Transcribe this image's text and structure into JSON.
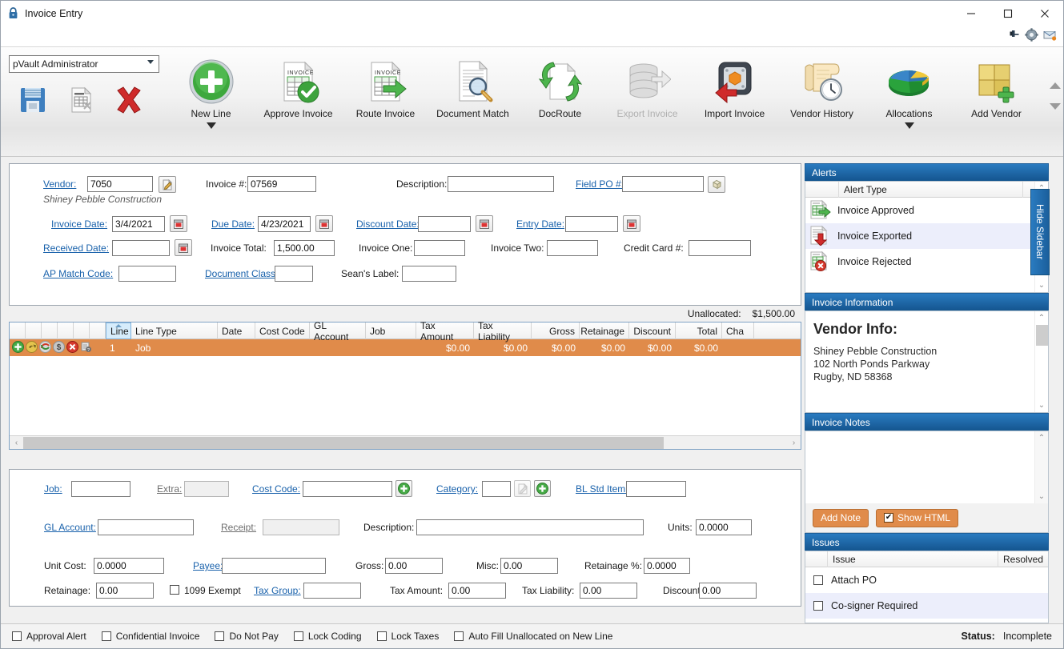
{
  "window": {
    "title": "Invoice Entry",
    "minimize": "—",
    "maximize": "▢",
    "close": "✕"
  },
  "quick_icons": [
    "pin-icon",
    "gear-icon",
    "mail-icon"
  ],
  "ribbon": {
    "user_select": {
      "value": "pVault Administrator"
    },
    "small_buttons": [
      {
        "name": "save-button",
        "icon": "floppy-disk-icon"
      },
      {
        "name": "save-invoice-button",
        "icon": "invoice-document-icon"
      },
      {
        "name": "delete-button",
        "icon": "red-x-icon"
      }
    ],
    "items": [
      {
        "label": "New Line",
        "icon": "green-plus-circle-icon",
        "disabled": false,
        "dropdown": true
      },
      {
        "label": "Approve Invoice",
        "icon": "invoice-check-icon",
        "disabled": false,
        "dropdown": false
      },
      {
        "label": "Route Invoice",
        "icon": "invoice-arrow-icon",
        "disabled": false,
        "dropdown": false
      },
      {
        "label": "Document Match",
        "icon": "document-magnifier-icon",
        "disabled": false,
        "dropdown": false
      },
      {
        "label": "DocRoute",
        "icon": "document-refresh-icon",
        "disabled": false,
        "dropdown": false
      },
      {
        "label": "Export Invoice",
        "icon": "database-export-icon",
        "disabled": true,
        "dropdown": false
      },
      {
        "label": "Import Invoice",
        "icon": "import-arrow-icon",
        "disabled": false,
        "dropdown": false
      },
      {
        "label": "Vendor History",
        "icon": "scroll-clock-icon",
        "disabled": false,
        "dropdown": false
      },
      {
        "label": "Allocations",
        "icon": "pie-chart-icon",
        "disabled": false,
        "dropdown": true
      },
      {
        "label": "Add Vendor",
        "icon": "box-plus-icon",
        "disabled": false,
        "dropdown": false
      }
    ]
  },
  "header_form": {
    "vendor_label": "Vendor:",
    "vendor_value": "7050",
    "vendor_name": "Shiney Pebble Construction",
    "invoice_num_label": "Invoice #:",
    "invoice_num_value": "07569",
    "description_label": "Description:",
    "description_value": "",
    "field_po_label": "Field PO #:",
    "field_po_value": "",
    "invoice_date_label": "Invoice Date:",
    "invoice_date_value": "3/4/2021",
    "due_date_label": "Due Date:",
    "due_date_value": "4/23/2021",
    "discount_date_label": "Discount Date:",
    "discount_date_value": "",
    "entry_date_label": "Entry Date:",
    "entry_date_value": "",
    "received_date_label": "Received Date:",
    "received_date_value": "",
    "invoice_total_label": "Invoice Total:",
    "invoice_total_value": "1,500.00",
    "invoice_one_label": "Invoice One:",
    "invoice_one_value": "",
    "invoice_two_label": "Invoice Two:",
    "invoice_two_value": "",
    "credit_card_label": "Credit Card #:",
    "credit_card_value": "",
    "ap_match_label": "AP Match Code:",
    "ap_match_value": "",
    "document_class_label": "Document Class:",
    "document_class_value": "",
    "seans_label_label": "Sean's Label:",
    "seans_label_value": ""
  },
  "unallocated": {
    "label": "Unallocated:",
    "value": "$1,500.00"
  },
  "grid": {
    "columns": [
      "Line",
      "Line Type",
      "Date",
      "Cost Code",
      "GL Account",
      "Job",
      "Tax Amount",
      "Tax Liability",
      "Gross",
      "Retainage",
      "Discount",
      "Total",
      "Cha"
    ],
    "sorted_column": "Line",
    "row_icons": [
      "add-line-icon",
      "undo-icon",
      "refresh-icon",
      "dollar-icon",
      "delete-icon",
      "info-icon"
    ],
    "rows": [
      {
        "line": "1",
        "line_type": "Job",
        "date": "",
        "cost_code": "",
        "gl_account": "",
        "job": "",
        "tax_amount": "$0.00",
        "tax_liability": "$0.00",
        "gross": "$0.00",
        "retainage": "$0.00",
        "discount": "$0.00",
        "total": "$0.00"
      }
    ]
  },
  "detail_form": {
    "job_label": "Job:",
    "job_value": "",
    "extra_label": "Extra:",
    "extra_value": "",
    "cost_code_label": "Cost Code:",
    "cost_code_value": "",
    "category_label": "Category:",
    "category_value": "",
    "bl_std_item_label": "BL Std Item:",
    "bl_std_item_value": "",
    "gl_account_label": "GL Account:",
    "gl_account_value": "",
    "receipt_label": "Receipt:",
    "receipt_value": "",
    "description_label": "Description:",
    "description_value": "",
    "units_label": "Units:",
    "units_value": "0.0000",
    "unit_cost_label": "Unit Cost:",
    "unit_cost_value": "0.0000",
    "payee_label": "Payee:",
    "payee_value": "",
    "gross_label": "Gross:",
    "gross_value": "0.00",
    "misc_label": "Misc:",
    "misc_value": "0.00",
    "retainage_pct_label": "Retainage %:",
    "retainage_pct_value": "0.0000",
    "retainage_label": "Retainage:",
    "retainage_value": "0.00",
    "exempt_1099_label": "1099 Exempt",
    "exempt_1099_checked": false,
    "tax_group_label": "Tax Group:",
    "tax_group_value": "",
    "tax_amount_label": "Tax Amount:",
    "tax_amount_value": "0.00",
    "tax_liability_label": "Tax Liability:",
    "tax_liability_value": "0.00",
    "discount_label": "Discount:",
    "discount_value": "0.00"
  },
  "sidebar": {
    "hide_label": "Hide Sidebar",
    "alerts": {
      "title": "Alerts",
      "column_blank": "",
      "column_type": "Alert Type",
      "rows": [
        {
          "label": "Invoice Approved",
          "icon": "invoice-green-arrow-icon",
          "selected": false
        },
        {
          "label": "Invoice Exported",
          "icon": "invoice-red-down-arrow-icon",
          "selected": true
        },
        {
          "label": "Invoice Rejected",
          "icon": "invoice-red-x-icon",
          "selected": false
        }
      ]
    },
    "invoice_information": {
      "title": "Invoice Information",
      "vendor_heading": "Vendor Info:",
      "lines": [
        "Shiney Pebble Construction",
        "102 North Ponds Parkway",
        "Rugby, ND 58368"
      ]
    },
    "invoice_notes": {
      "title": "Invoice Notes",
      "body": "",
      "add_note_label": "Add Note",
      "show_html_label": "Show HTML",
      "show_html_checked": true
    },
    "issues": {
      "title": "Issues",
      "column_issue": "Issue",
      "column_resolved": "Resolved",
      "rows": [
        {
          "label": "Attach PO",
          "resolved": false
        },
        {
          "label": "Co-signer Required",
          "resolved": false
        }
      ]
    }
  },
  "statusbar": {
    "checkboxes": [
      {
        "label": "Approval Alert",
        "checked": false
      },
      {
        "label": "Confidential Invoice",
        "checked": false
      },
      {
        "label": "Do Not Pay",
        "checked": false
      },
      {
        "label": "Lock Coding",
        "checked": false
      },
      {
        "label": "Lock Taxes",
        "checked": false
      },
      {
        "label": "Auto Fill Unallocated on New Line",
        "checked": false
      }
    ],
    "status_label": "Status:",
    "status_value": "Incomplete"
  },
  "colors": {
    "accent_blue": "#1b5f9c",
    "row_orange": "#e08b4a",
    "link_blue": "#1861ab"
  }
}
